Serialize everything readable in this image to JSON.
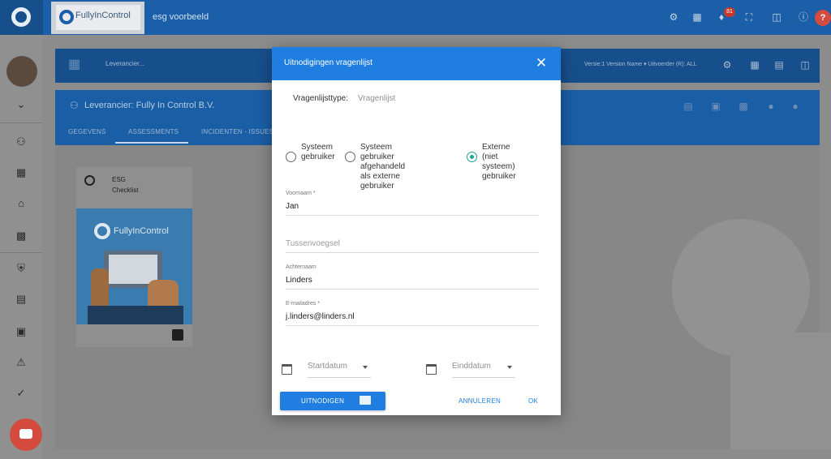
{
  "topbar": {
    "brand_text": "FullyInControl",
    "page_name": "esg voorbeeld",
    "notification_count": "81",
    "icons": [
      "user-settings-icon",
      "building-icon",
      "bell-icon",
      "fullscreen-icon",
      "gift-icon",
      "info-icon",
      "help-icon"
    ]
  },
  "sidebar": {
    "icons": [
      "chevron-down-icon",
      "user-network-icon",
      "building-icon",
      "home-icon",
      "dashboard-icon",
      "shield-icon",
      "calendar-icon",
      "monitor-icon",
      "warning-icon",
      "check-icon",
      "chat-icon"
    ]
  },
  "header": {
    "breadcrumb": "Leverancier...",
    "version": "Versie:1 Version Name ▾ Uitvoerder (R): ALL"
  },
  "supplier": {
    "title": "Leverancier: Fully In Control B.V.",
    "tabs": [
      "GEGEVENS",
      "ASSESSMENTS",
      "INCIDENTEN - ISSUES"
    ],
    "active_tab": "ASSESSMENTS"
  },
  "card": {
    "title_line1": "ESG",
    "title_line2": "Checklist",
    "image_text": "FullyInControl"
  },
  "modal": {
    "title": "Uitnodigingen vragenlijst",
    "type_label": "Vragenlijsttype:",
    "type_value": "Vragenlijst",
    "options": [
      {
        "line1": "Systeem",
        "line2": "gebruiker",
        "line3": "",
        "selected": false
      },
      {
        "line1": "Systeem gebruiker",
        "line2": "afgehandeld als externe",
        "line3": "gebruiker",
        "selected": false
      },
      {
        "line1": "Externe (niet",
        "line2": "systeem)",
        "line3": "gebruiker",
        "selected": true
      }
    ],
    "fields": {
      "voornaam_label": "Voornaam *",
      "voornaam_value": "Jan",
      "tussenvoegsel_placeholder": "Tussenvoegsel",
      "achternaam_label": "Achternaam",
      "achternaam_value": "Linders",
      "email_label": "E-mailadres *",
      "email_value": "j.linders@linders.nl"
    },
    "startdatum_placeholder": "Startdatum",
    "einddatum_placeholder": "Einddatum",
    "invite_button": "UITNODIGEN",
    "cancel_button": "ANNULEREN",
    "ok_button": "OK",
    "accent_color": "#1f7ee0",
    "selected_radio_color": "#1aa38e"
  }
}
